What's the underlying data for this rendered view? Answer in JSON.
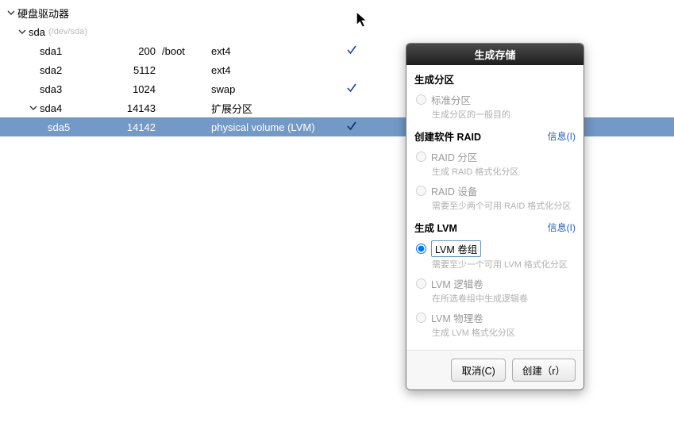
{
  "tree": {
    "root_label": "硬盘驱动器",
    "disk_label": "sda",
    "disk_devpath": "(/dev/sda)",
    "rows": [
      {
        "name": "sda1",
        "size": "200",
        "mount": "/boot",
        "type": "ext4",
        "checked": true
      },
      {
        "name": "sda2",
        "size": "5112",
        "mount": "",
        "type": "ext4",
        "checked": false
      },
      {
        "name": "sda3",
        "size": "1024",
        "mount": "",
        "type": "swap",
        "checked": true
      },
      {
        "name": "sda4",
        "size": "14143",
        "mount": "",
        "type": "扩展分区",
        "checked": false,
        "expandable": true
      },
      {
        "name": "sda5",
        "size": "14142",
        "mount": "",
        "type": "physical volume (LVM)",
        "checked": true,
        "selected": true,
        "indent": 3
      }
    ]
  },
  "dialog": {
    "title": "生成存储",
    "section_partition": "生成分区",
    "opt_standard": "标准分区",
    "opt_standard_desc": "生成分区的一般目的",
    "section_raid": "创建软件 RAID",
    "info_label": "信息(I)",
    "opt_raid_part": "RAID 分区",
    "opt_raid_part_desc": "生成 RAID 格式化分区",
    "opt_raid_dev": "RAID 设备",
    "opt_raid_dev_desc": "需要至少两个可用 RAID 格式化分区",
    "section_lvm": "生成 LVM",
    "opt_lvm_vg": "LVM 卷组",
    "opt_lvm_vg_desc": "需要至少一个可用 LVM 格式化分区",
    "opt_lvm_lv": "LVM 逻辑卷",
    "opt_lvm_lv_desc": "在所选卷组中生成逻辑卷",
    "opt_lvm_pv": "LVM 物理卷",
    "opt_lvm_pv_desc": "生成 LVM 格式化分区",
    "btn_cancel": "取消(C)",
    "btn_create": "创建（r）"
  }
}
